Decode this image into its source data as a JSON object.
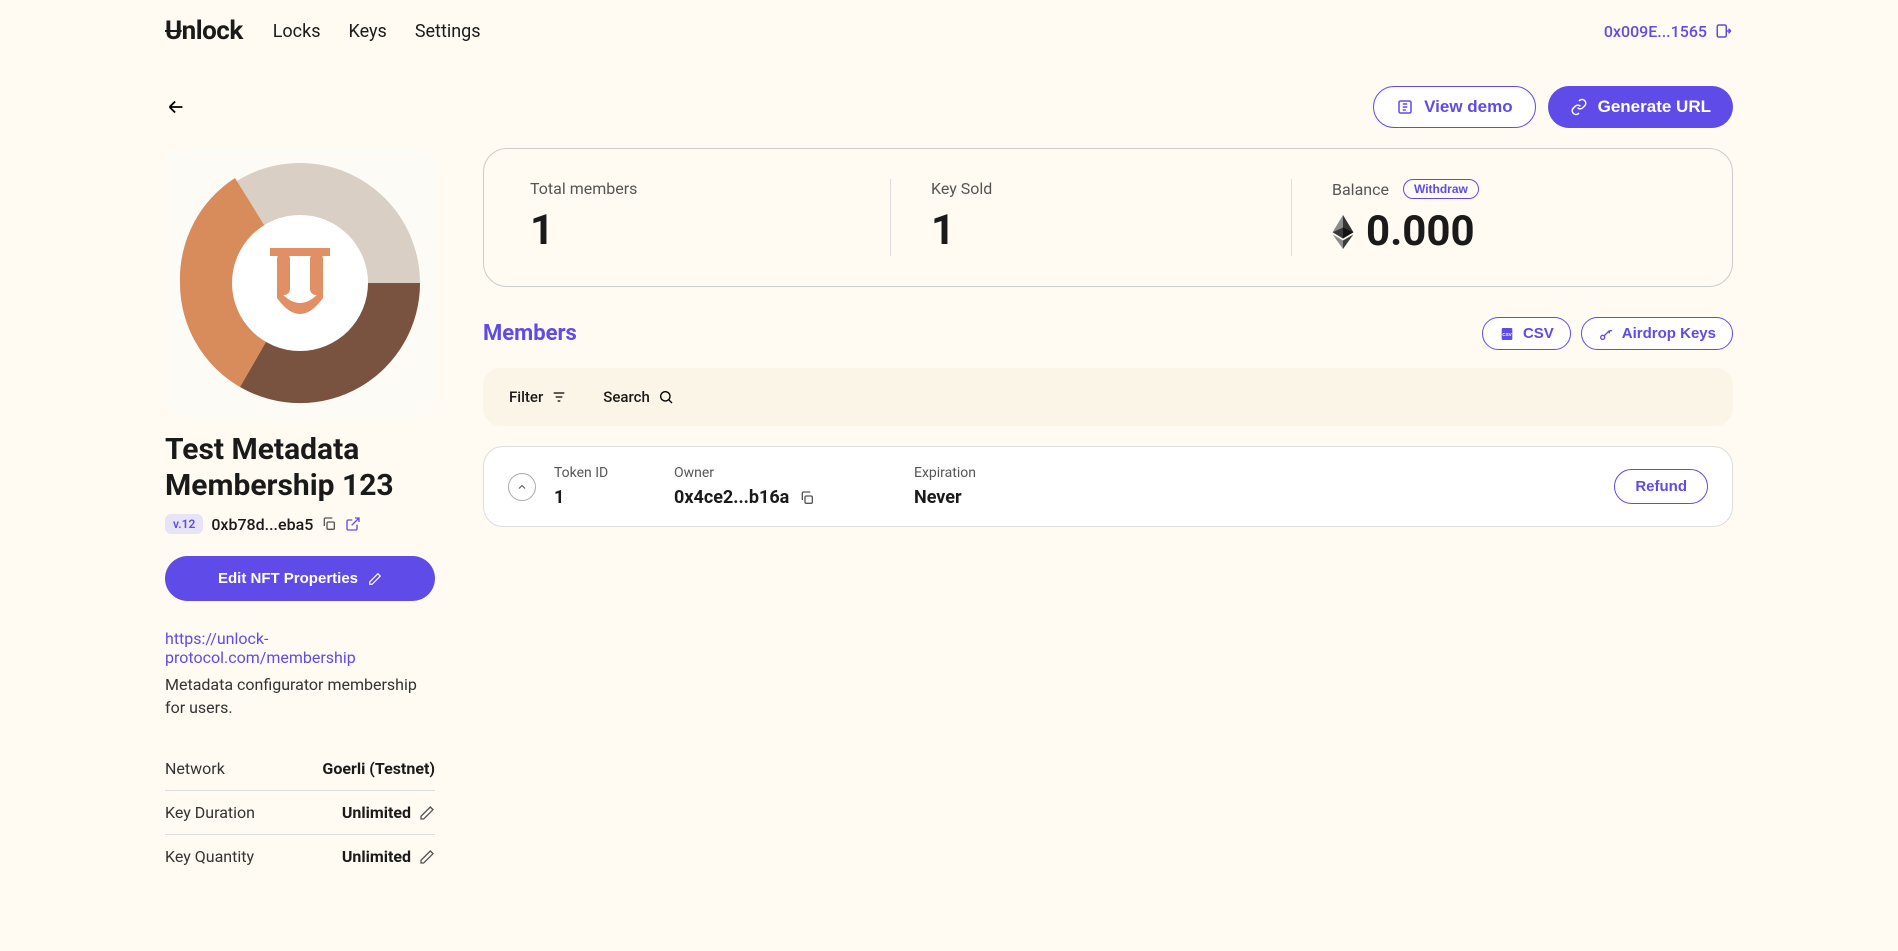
{
  "header": {
    "logo": "Unlock",
    "nav": {
      "locks": "Locks",
      "keys": "Keys",
      "settings": "Settings"
    },
    "wallet_address": "0x009E...1565"
  },
  "topbar": {
    "view_demo": "View demo",
    "generate_url": "Generate URL"
  },
  "lock": {
    "title": "Test Metadata Membership 123",
    "version": "v.12",
    "address": "0xb78d...eba5",
    "edit_label": "Edit NFT Properties",
    "url": "https://unlock-protocol.com/membership",
    "description": "Metadata configurator membership for users.",
    "details": {
      "network_label": "Network",
      "network_value": "Goerli (Testnet)",
      "duration_label": "Key Duration",
      "duration_value": "Unlimited",
      "quantity_label": "Key Quantity",
      "quantity_value": "Unlimited"
    }
  },
  "stats": {
    "total_members_label": "Total members",
    "total_members_value": "1",
    "key_sold_label": "Key Sold",
    "key_sold_value": "1",
    "balance_label": "Balance",
    "balance_value": "0.000",
    "withdraw_label": "Withdraw"
  },
  "members": {
    "title": "Members",
    "csv_label": "CSV",
    "airdrop_label": "Airdrop Keys",
    "filter_label": "Filter",
    "search_label": "Search",
    "row": {
      "token_id_label": "Token ID",
      "token_id_value": "1",
      "owner_label": "Owner",
      "owner_value": "0x4ce2...b16a",
      "expiration_label": "Expiration",
      "expiration_value": "Never",
      "refund_label": "Refund"
    }
  }
}
